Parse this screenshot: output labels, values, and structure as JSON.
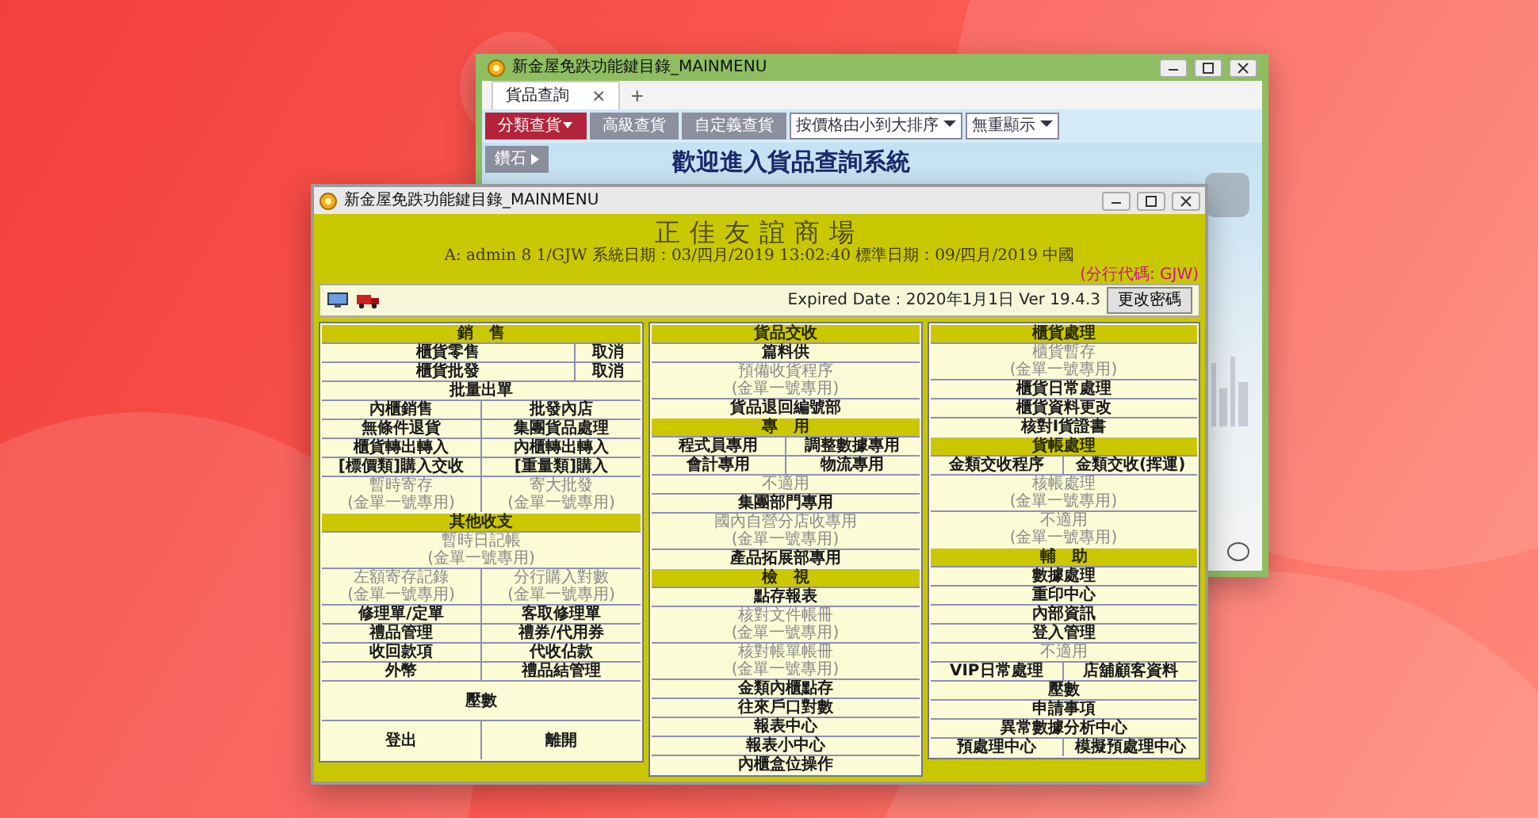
{
  "back_window": {
    "title": "新金屋免跌功能鍵目錄_MAINMENU",
    "tabs": [
      {
        "label": "貨品查詢",
        "selected": true
      }
    ],
    "close_tab": "×",
    "new_tab": "+",
    "nav": [
      {
        "label": "分類查貨",
        "kind": "dropdown",
        "selected": true
      },
      {
        "label": "高級查貨",
        "kind": "plain",
        "selected": false
      },
      {
        "label": "自定義查貨",
        "kind": "plain",
        "selected": false
      }
    ],
    "selects": [
      {
        "value": "按價格由小到大排序"
      },
      {
        "value": "無重顯示"
      }
    ],
    "side_menu": [
      {
        "label": "鑽石"
      }
    ],
    "banner": "歡迎進入貨品查詢系統"
  },
  "front_window": {
    "title": "新金屋免跌功能鍵目錄_MAINMENU",
    "company": "正佳友誼商場",
    "info": "A: admin 8 1/GJW 系統日期：03/四月/2019 13:02:40 標準日期：09/四月/2019 中國",
    "branch": "(分行代碼: GJW)",
    "expiry": "Expired Date : 2020年1月1日 Ver 19.4.3",
    "password_button": "更改密碼",
    "columns": [
      [
        {
          "title": "銷　售",
          "rows": [
            {
              "kind": "split",
              "cells": [
                {
                  "label": "櫃貨零售",
                  "disabled": false
                },
                {
                  "label": "取消",
                  "disabled": false
                }
              ]
            },
            {
              "kind": "split",
              "cells": [
                {
                  "label": "櫃貨批發",
                  "disabled": false
                },
                {
                  "label": "取消",
                  "disabled": false
                }
              ]
            },
            {
              "kind": "even",
              "cells": [
                {
                  "label": "批量出單",
                  "disabled": false
                }
              ]
            },
            {
              "kind": "even",
              "cells": [
                {
                  "label": "內櫃銷售",
                  "disabled": false
                },
                {
                  "label": "批發內店",
                  "disabled": false
                }
              ]
            },
            {
              "kind": "even",
              "cells": [
                {
                  "label": "無條件退貨",
                  "disabled": false
                },
                {
                  "label": "集團貨品處理",
                  "disabled": false
                }
              ]
            },
            {
              "kind": "even",
              "cells": [
                {
                  "label": "櫃貨轉出轉入",
                  "disabled": false
                },
                {
                  "label": "內櫃轉出轉入",
                  "disabled": false
                }
              ]
            },
            {
              "kind": "even",
              "cells": [
                {
                  "label": "[標價類]購入交收",
                  "disabled": false
                },
                {
                  "label": "[重量類]購入",
                  "disabled": false
                }
              ]
            },
            {
              "kind": "even",
              "cells": [
                {
                  "label": "暫時寄存",
                  "sub": "(金單一號專用)",
                  "disabled": true
                },
                {
                  "label": "寄大批發",
                  "sub": "(金單一號專用)",
                  "disabled": true
                }
              ]
            }
          ]
        },
        {
          "title": "其他收支",
          "rows": [
            {
              "kind": "even",
              "cells": [
                {
                  "label": "暫時日記帳",
                  "sub": "(金單一號專用)",
                  "disabled": true
                }
              ]
            },
            {
              "kind": "even",
              "cells": [
                {
                  "label": "左額寄存記錄",
                  "sub": "(金單一號專用)",
                  "disabled": true
                },
                {
                  "label": "分行購入對數",
                  "sub": "(金單一號專用)",
                  "disabled": true
                }
              ]
            },
            {
              "kind": "even",
              "cells": [
                {
                  "label": "修理單/定單",
                  "disabled": false
                },
                {
                  "label": "客取修理單",
                  "disabled": false
                }
              ]
            },
            {
              "kind": "even",
              "cells": [
                {
                  "label": "禮品管理",
                  "disabled": false
                },
                {
                  "label": "禮券/代用券",
                  "disabled": false
                }
              ]
            },
            {
              "kind": "even",
              "cells": [
                {
                  "label": "收回款項",
                  "disabled": false
                },
                {
                  "label": "代收佔款",
                  "disabled": false
                }
              ]
            },
            {
              "kind": "even",
              "cells": [
                {
                  "label": "外幣",
                  "disabled": false
                },
                {
                  "label": "禮品結管理",
                  "disabled": false
                }
              ]
            },
            {
              "kind": "tall",
              "cells": [
                {
                  "label": "壓數",
                  "disabled": false
                }
              ]
            },
            {
              "kind": "tall",
              "cells": [
                {
                  "label": "登出",
                  "disabled": false
                },
                {
                  "label": "離開",
                  "disabled": false
                }
              ]
            }
          ]
        }
      ],
      [
        {
          "title": "貨品交收",
          "rows": [
            {
              "kind": "even",
              "cells": [
                {
                  "label": "篇料供",
                  "disabled": false
                }
              ]
            },
            {
              "kind": "even",
              "cells": [
                {
                  "label": "預備收貨程序",
                  "sub": "(金單一號專用)",
                  "disabled": true
                }
              ]
            },
            {
              "kind": "even",
              "cells": [
                {
                  "label": "貨品退回編號部",
                  "disabled": false
                }
              ]
            }
          ]
        },
        {
          "title": "專　用",
          "rows": [
            {
              "kind": "even",
              "cells": [
                {
                  "label": "程式員專用",
                  "disabled": false
                },
                {
                  "label": "調整數據專用",
                  "disabled": false
                }
              ]
            },
            {
              "kind": "even",
              "cells": [
                {
                  "label": "會計專用",
                  "disabled": false
                },
                {
                  "label": "物流專用",
                  "disabled": false
                }
              ]
            },
            {
              "kind": "even",
              "cells": [
                {
                  "label": "不適用",
                  "disabled": true
                }
              ]
            },
            {
              "kind": "even",
              "cells": [
                {
                  "label": "集團部門專用",
                  "disabled": false
                }
              ]
            },
            {
              "kind": "even",
              "cells": [
                {
                  "label": "國內自營分店收專用",
                  "sub": "(金單一號專用)",
                  "disabled": true
                }
              ]
            },
            {
              "kind": "even",
              "cells": [
                {
                  "label": "產品拓展部專用",
                  "disabled": false
                }
              ]
            }
          ]
        },
        {
          "title": "檢　視",
          "rows": [
            {
              "kind": "even",
              "cells": [
                {
                  "label": "點存報表",
                  "disabled": false
                }
              ]
            },
            {
              "kind": "even",
              "cells": [
                {
                  "label": "核對文件帳冊",
                  "sub": "(金單一號專用)",
                  "disabled": true
                }
              ]
            },
            {
              "kind": "even",
              "cells": [
                {
                  "label": "核對帳單帳冊",
                  "sub": "(金單一號專用)",
                  "disabled": true
                }
              ]
            },
            {
              "kind": "even",
              "cells": [
                {
                  "label": "金類內櫃點存",
                  "disabled": false
                }
              ]
            },
            {
              "kind": "even",
              "cells": [
                {
                  "label": "往來戶口對數",
                  "disabled": false
                }
              ]
            },
            {
              "kind": "even",
              "cells": [
                {
                  "label": "報表中心",
                  "disabled": false
                }
              ]
            },
            {
              "kind": "even",
              "cells": [
                {
                  "label": "報表小中心",
                  "disabled": false
                }
              ]
            },
            {
              "kind": "even",
              "cells": [
                {
                  "label": "內櫃盒位操作",
                  "disabled": false
                }
              ]
            }
          ]
        }
      ],
      [
        {
          "title": "櫃貨處理",
          "rows": [
            {
              "kind": "even",
              "cells": [
                {
                  "label": "櫃貨暫存",
                  "sub": "(金單一號專用)",
                  "disabled": true
                }
              ]
            },
            {
              "kind": "even",
              "cells": [
                {
                  "label": "櫃貨日常處理",
                  "disabled": false
                }
              ]
            },
            {
              "kind": "even",
              "cells": [
                {
                  "label": "櫃貨資料更改",
                  "disabled": false
                }
              ]
            },
            {
              "kind": "even",
              "cells": [
                {
                  "label": "核對I貨證書",
                  "disabled": false
                }
              ]
            }
          ]
        },
        {
          "title": "貨帳處理",
          "rows": [
            {
              "kind": "even",
              "cells": [
                {
                  "label": "金類交收程序",
                  "disabled": false
                },
                {
                  "label": "金類交收(挥運)",
                  "disabled": false
                }
              ]
            },
            {
              "kind": "even",
              "cells": [
                {
                  "label": "核帳處理",
                  "sub": "(金單一號專用)",
                  "disabled": true
                }
              ]
            },
            {
              "kind": "even",
              "cells": [
                {
                  "label": "不適用",
                  "sub": "(金單一號專用)",
                  "disabled": true
                }
              ]
            }
          ]
        },
        {
          "title": "輔　助",
          "rows": [
            {
              "kind": "even",
              "cells": [
                {
                  "label": "數據處理",
                  "disabled": false
                }
              ]
            },
            {
              "kind": "even",
              "cells": [
                {
                  "label": "重印中心",
                  "disabled": false
                }
              ]
            },
            {
              "kind": "even",
              "cells": [
                {
                  "label": "內部資訊",
                  "disabled": false
                }
              ]
            },
            {
              "kind": "even",
              "cells": [
                {
                  "label": "登入管理",
                  "disabled": false
                }
              ]
            },
            {
              "kind": "even",
              "cells": [
                {
                  "label": "不適用",
                  "disabled": true
                }
              ]
            },
            {
              "kind": "even",
              "cells": [
                {
                  "label": "VIP日常處理",
                  "disabled": false
                },
                {
                  "label": "店舖顧客資料",
                  "disabled": false
                }
              ]
            },
            {
              "kind": "even",
              "cells": [
                {
                  "label": "壓數",
                  "disabled": false
                }
              ]
            },
            {
              "kind": "even",
              "cells": [
                {
                  "label": "申請事項",
                  "disabled": false
                }
              ]
            },
            {
              "kind": "even",
              "cells": [
                {
                  "label": "異常數據分析中心",
                  "disabled": false
                }
              ]
            },
            {
              "kind": "even",
              "cells": [
                {
                  "label": "預處理中心",
                  "disabled": false
                },
                {
                  "label": "模擬預處理中心",
                  "disabled": false
                }
              ]
            }
          ]
        }
      ]
    ]
  }
}
